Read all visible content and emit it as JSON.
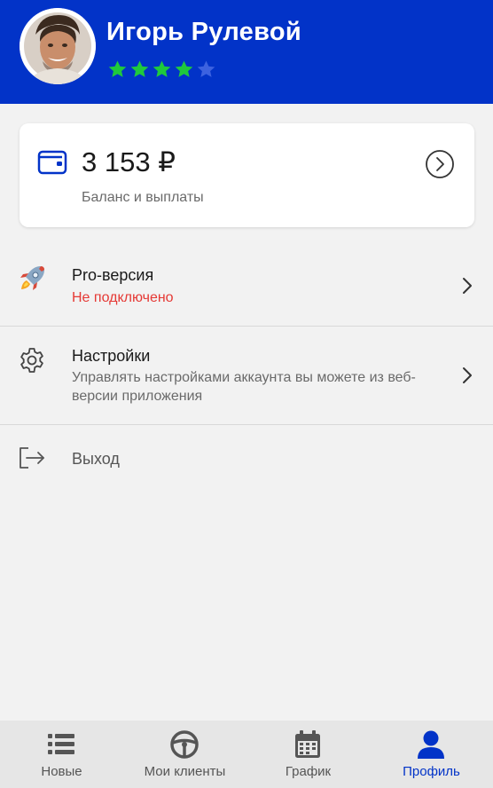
{
  "colors": {
    "brand": "#0233c8",
    "star_active": "#1fc93c",
    "star_inactive": "#3c62e0",
    "danger": "#e53935",
    "icon": "#555555",
    "wallet": "#0233c8"
  },
  "profile": {
    "name": "Игорь Рулевой",
    "rating": 4,
    "rating_max": 5,
    "avatar_icon": "user-photo"
  },
  "balance": {
    "amount": "3 153 ₽",
    "label": "Баланс и выплаты",
    "icon": "wallet-icon"
  },
  "menu": {
    "pro": {
      "title": "Pro-версия",
      "status": "Не подключено",
      "icon": "rocket-icon"
    },
    "settings": {
      "title": "Настройки",
      "description": "Управлять настройками аккаунта вы можете из веб-версии приложения",
      "icon": "gear-icon"
    },
    "logout": {
      "title": "Выход",
      "icon": "logout-icon"
    }
  },
  "nav": {
    "tabs": [
      {
        "label": "Новые",
        "icon": "list-icon",
        "active": false
      },
      {
        "label": "Мои клиенты",
        "icon": "steering-wheel-icon",
        "active": false
      },
      {
        "label": "График",
        "icon": "calendar-icon",
        "active": false
      },
      {
        "label": "Профиль",
        "icon": "person-icon",
        "active": true
      }
    ]
  }
}
